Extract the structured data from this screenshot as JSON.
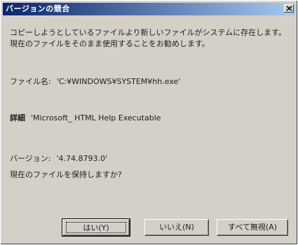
{
  "window": {
    "title": "バージョンの競合"
  },
  "message": {
    "line1": "コピーしようとしているファイルより新しいファイルがシステムに存在します。",
    "line2": "現在のファイルをそのまま使用することをお勧めします。"
  },
  "file": {
    "label": "ファイル名:",
    "value": "'C:¥WINDOWS¥SYSTEM¥hh.exe'"
  },
  "detail": {
    "label": "詳細",
    "value": "'Microsoft_ HTML Help Executable"
  },
  "version": {
    "label": "バージョン:",
    "value": "'4.74.8793.0'"
  },
  "question": "現在のファイルを保持しますか?",
  "buttons": {
    "yes": "はい(Y)",
    "no": "いいえ(N)",
    "ignore_all": "すべて無視(A)"
  }
}
